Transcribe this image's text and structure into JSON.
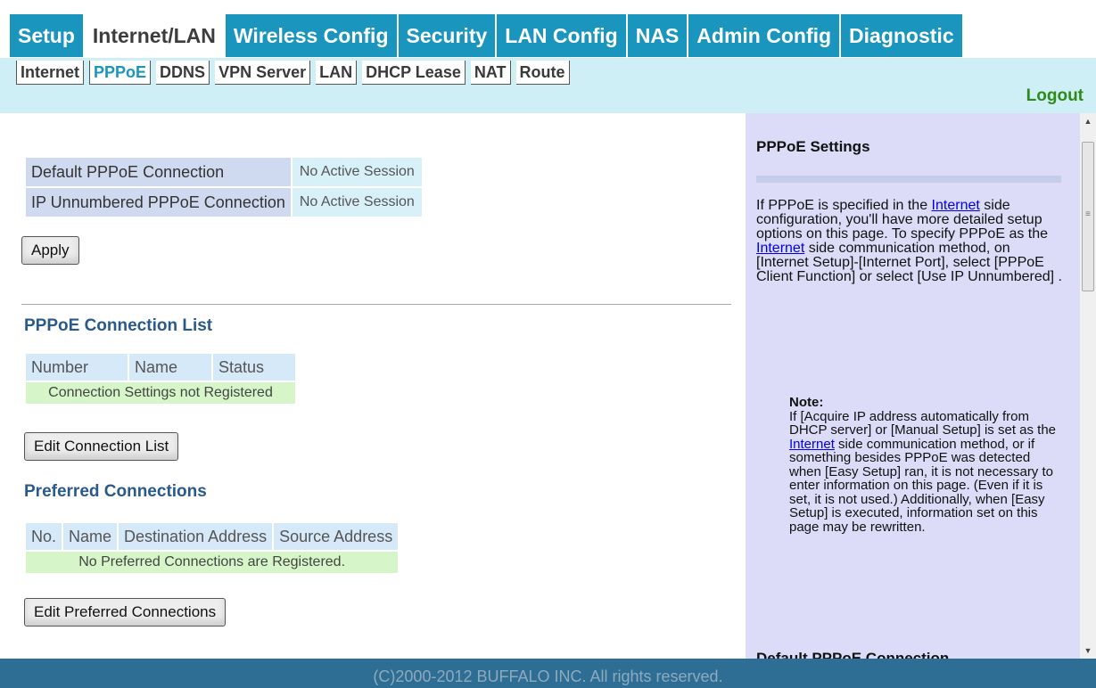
{
  "top_tabs": [
    "Setup",
    "Internet/LAN",
    "Wireless Config",
    "Security",
    "LAN Config",
    "NAS",
    "Admin Config",
    "Diagnostic"
  ],
  "active_top_tab": "Internet/LAN",
  "sub_tabs": [
    "Internet",
    "PPPoE",
    "DDNS",
    "VPN Server",
    "LAN",
    "DHCP Lease",
    "NAT",
    "Route"
  ],
  "active_sub_tab": "PPPoE",
  "logout_label": "Logout",
  "status": {
    "rows": [
      {
        "label": "Default PPPoE Connection",
        "value": "No Active Session"
      },
      {
        "label": "IP Unnumbered PPPoE Connection",
        "value": "No Active Session"
      }
    ]
  },
  "apply_label": "Apply",
  "conn_list": {
    "heading": "PPPoE Connection List",
    "columns": [
      "Number",
      "Name",
      "Status"
    ],
    "empty_text": "Connection Settings not Registered",
    "edit_label": "Edit Connection List"
  },
  "preferred": {
    "heading": "Preferred Connections",
    "columns": [
      "No.",
      "Name",
      "Destination Address",
      "Source Address"
    ],
    "empty_text": "No Preferred Connections are Registered.",
    "edit_label": "Edit Preferred Connections"
  },
  "help": {
    "title": "PPPoE Settings",
    "p1_a": "If PPPoE is specified in the ",
    "link1": "Internet",
    "p1_b": " side configuration, you'll have more detailed setup options on this page. To specify PPPoE as the ",
    "link2": "Internet",
    "p1_c": " side communication method, on [Internet Setup]-[Internet Port], select [PPPoE Client Function] or select [Use IP Unnumbered] .",
    "note_title": "Note:",
    "note_a": "If [Acquire IP address automatically from DHCP server] or [Manual Setup] is set as the ",
    "note_link": "Internet",
    "note_b": " side communication method, or if something besides PPPoE was detected when [Easy Setup] ran, it is not necessary to enter information on this page. (Even if it is set, it is not used.) Additionally, when [Easy Setup] is executed, information set on this page may be rewritten.",
    "sub_title": "Default PPPoE Connection"
  },
  "footer": "(C)2000-2012 BUFFALO INC. All rights reserved.",
  "colors": {
    "tab_blue": "#1a95be",
    "sub_bar": "#cfeff6",
    "help_bg": "#dcdcf8",
    "footer": "#2e6e94",
    "logout": "#2e8b17",
    "heading": "#2a5a8c"
  }
}
